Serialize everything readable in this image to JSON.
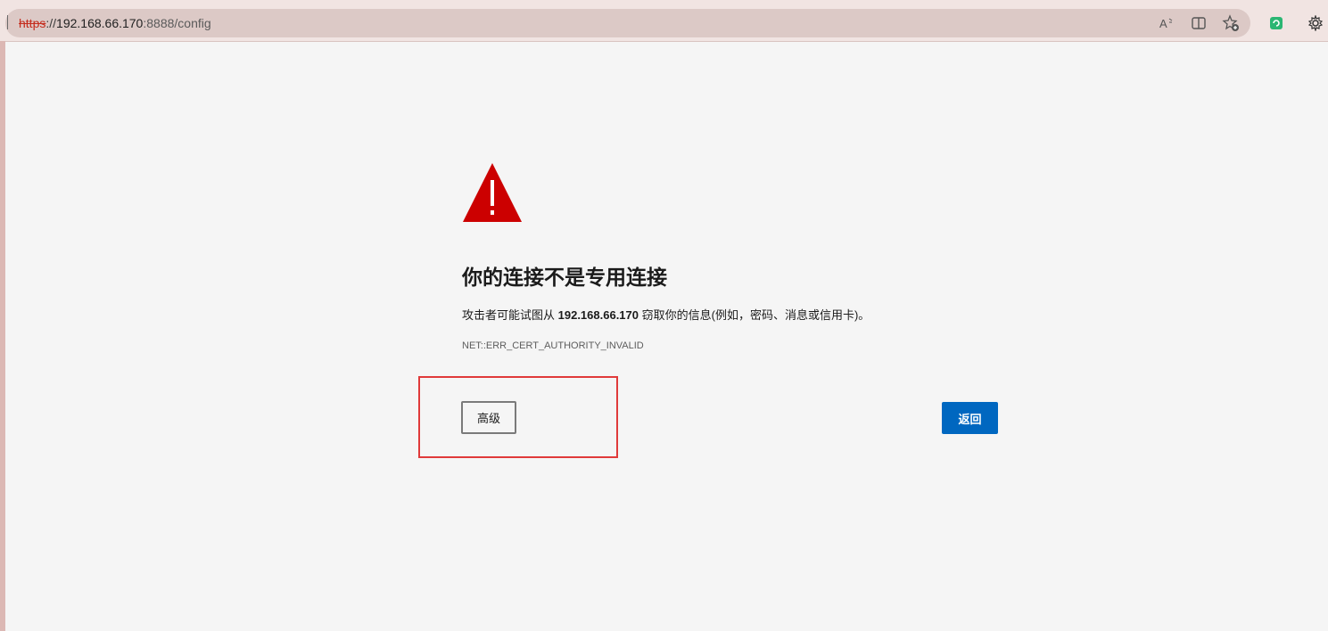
{
  "browser": {
    "url_scheme": "https",
    "url_separator": "://",
    "url_host": "192.168.66.170",
    "url_rest": ":8888/config",
    "icons": [
      "read-aloud-icon",
      "split-screen-icon",
      "add-favorite-icon",
      "extension-icon",
      "settings-gear-icon"
    ]
  },
  "error": {
    "title": "你的连接不是专用连接",
    "desc_prefix": "攻击者可能试图从 ",
    "desc_host": "192.168.66.170",
    "desc_suffix": " 窃取你的信息(例如，密码、消息或信用卡)。",
    "code": "NET::ERR_CERT_AUTHORITY_INVALID",
    "advanced_label": "高级",
    "back_label": "返回"
  },
  "colors": {
    "warning_red": "#cc0000",
    "primary_button": "#0067c0",
    "highlight_border": "#e03a3a"
  }
}
